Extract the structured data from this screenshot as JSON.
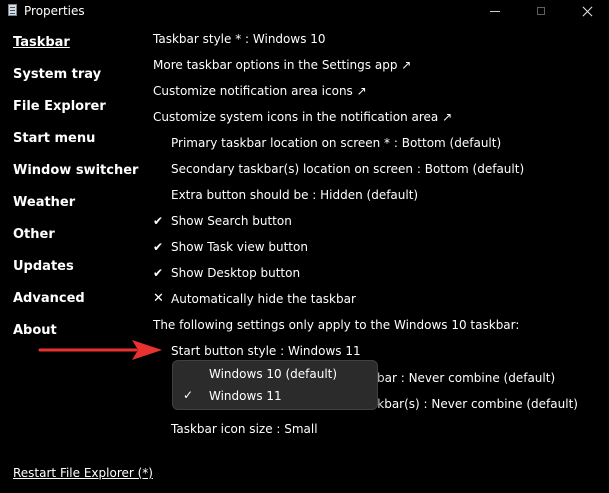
{
  "window": {
    "title": "Properties",
    "icons": {
      "app": "properties-app-icon",
      "minimize": "minimize-icon",
      "maximize": "maximize-icon",
      "close": "close-icon"
    }
  },
  "sidebar": {
    "items": [
      {
        "label": "Taskbar",
        "active": true
      },
      {
        "label": "System tray"
      },
      {
        "label": "File Explorer"
      },
      {
        "label": "Start menu"
      },
      {
        "label": "Window switcher"
      },
      {
        "label": "Weather"
      },
      {
        "label": "Other"
      },
      {
        "label": "Updates"
      },
      {
        "label": "Advanced"
      },
      {
        "label": "About"
      }
    ],
    "restart_label": "Restart File Explorer (*)"
  },
  "settings": {
    "taskbar_style": "Taskbar style * : Windows 10",
    "more_options": "More taskbar options in the Settings app ↗",
    "notif_icons": "Customize notification area icons ↗",
    "system_icons": "Customize system icons in the notification area ↗",
    "primary_location": "Primary taskbar location on screen * : Bottom (default)",
    "secondary_location": "Secondary taskbar(s) location on screen : Bottom (default)",
    "extra_button": "Extra button should be : Hidden (default)",
    "show_search": "Show Search button",
    "show_taskview": "Show Task view button",
    "show_desktop": "Show Desktop button",
    "auto_hide": "Automatically hide the taskbar",
    "win10_note": "The following settings only apply to the Windows 10 taskbar:",
    "start_button_style": "Start button style : Windows 11",
    "combine_primary_partial": "bar : Never combine (default)",
    "combine_secondary_partial": "skbar(s) : Never combine (default)",
    "icon_size": "Taskbar icon size : Small",
    "check_glyph": "✔",
    "cross_glyph": "✕"
  },
  "dropdown": {
    "options": [
      {
        "label": "Windows 10 (default)",
        "selected": false
      },
      {
        "label": "Windows 11",
        "selected": true
      }
    ],
    "check_glyph": "✓"
  },
  "colors": {
    "background": "#000000",
    "text": "#ffffff",
    "popup_bg": "#2b2b2b",
    "arrow": "#e8322f"
  }
}
